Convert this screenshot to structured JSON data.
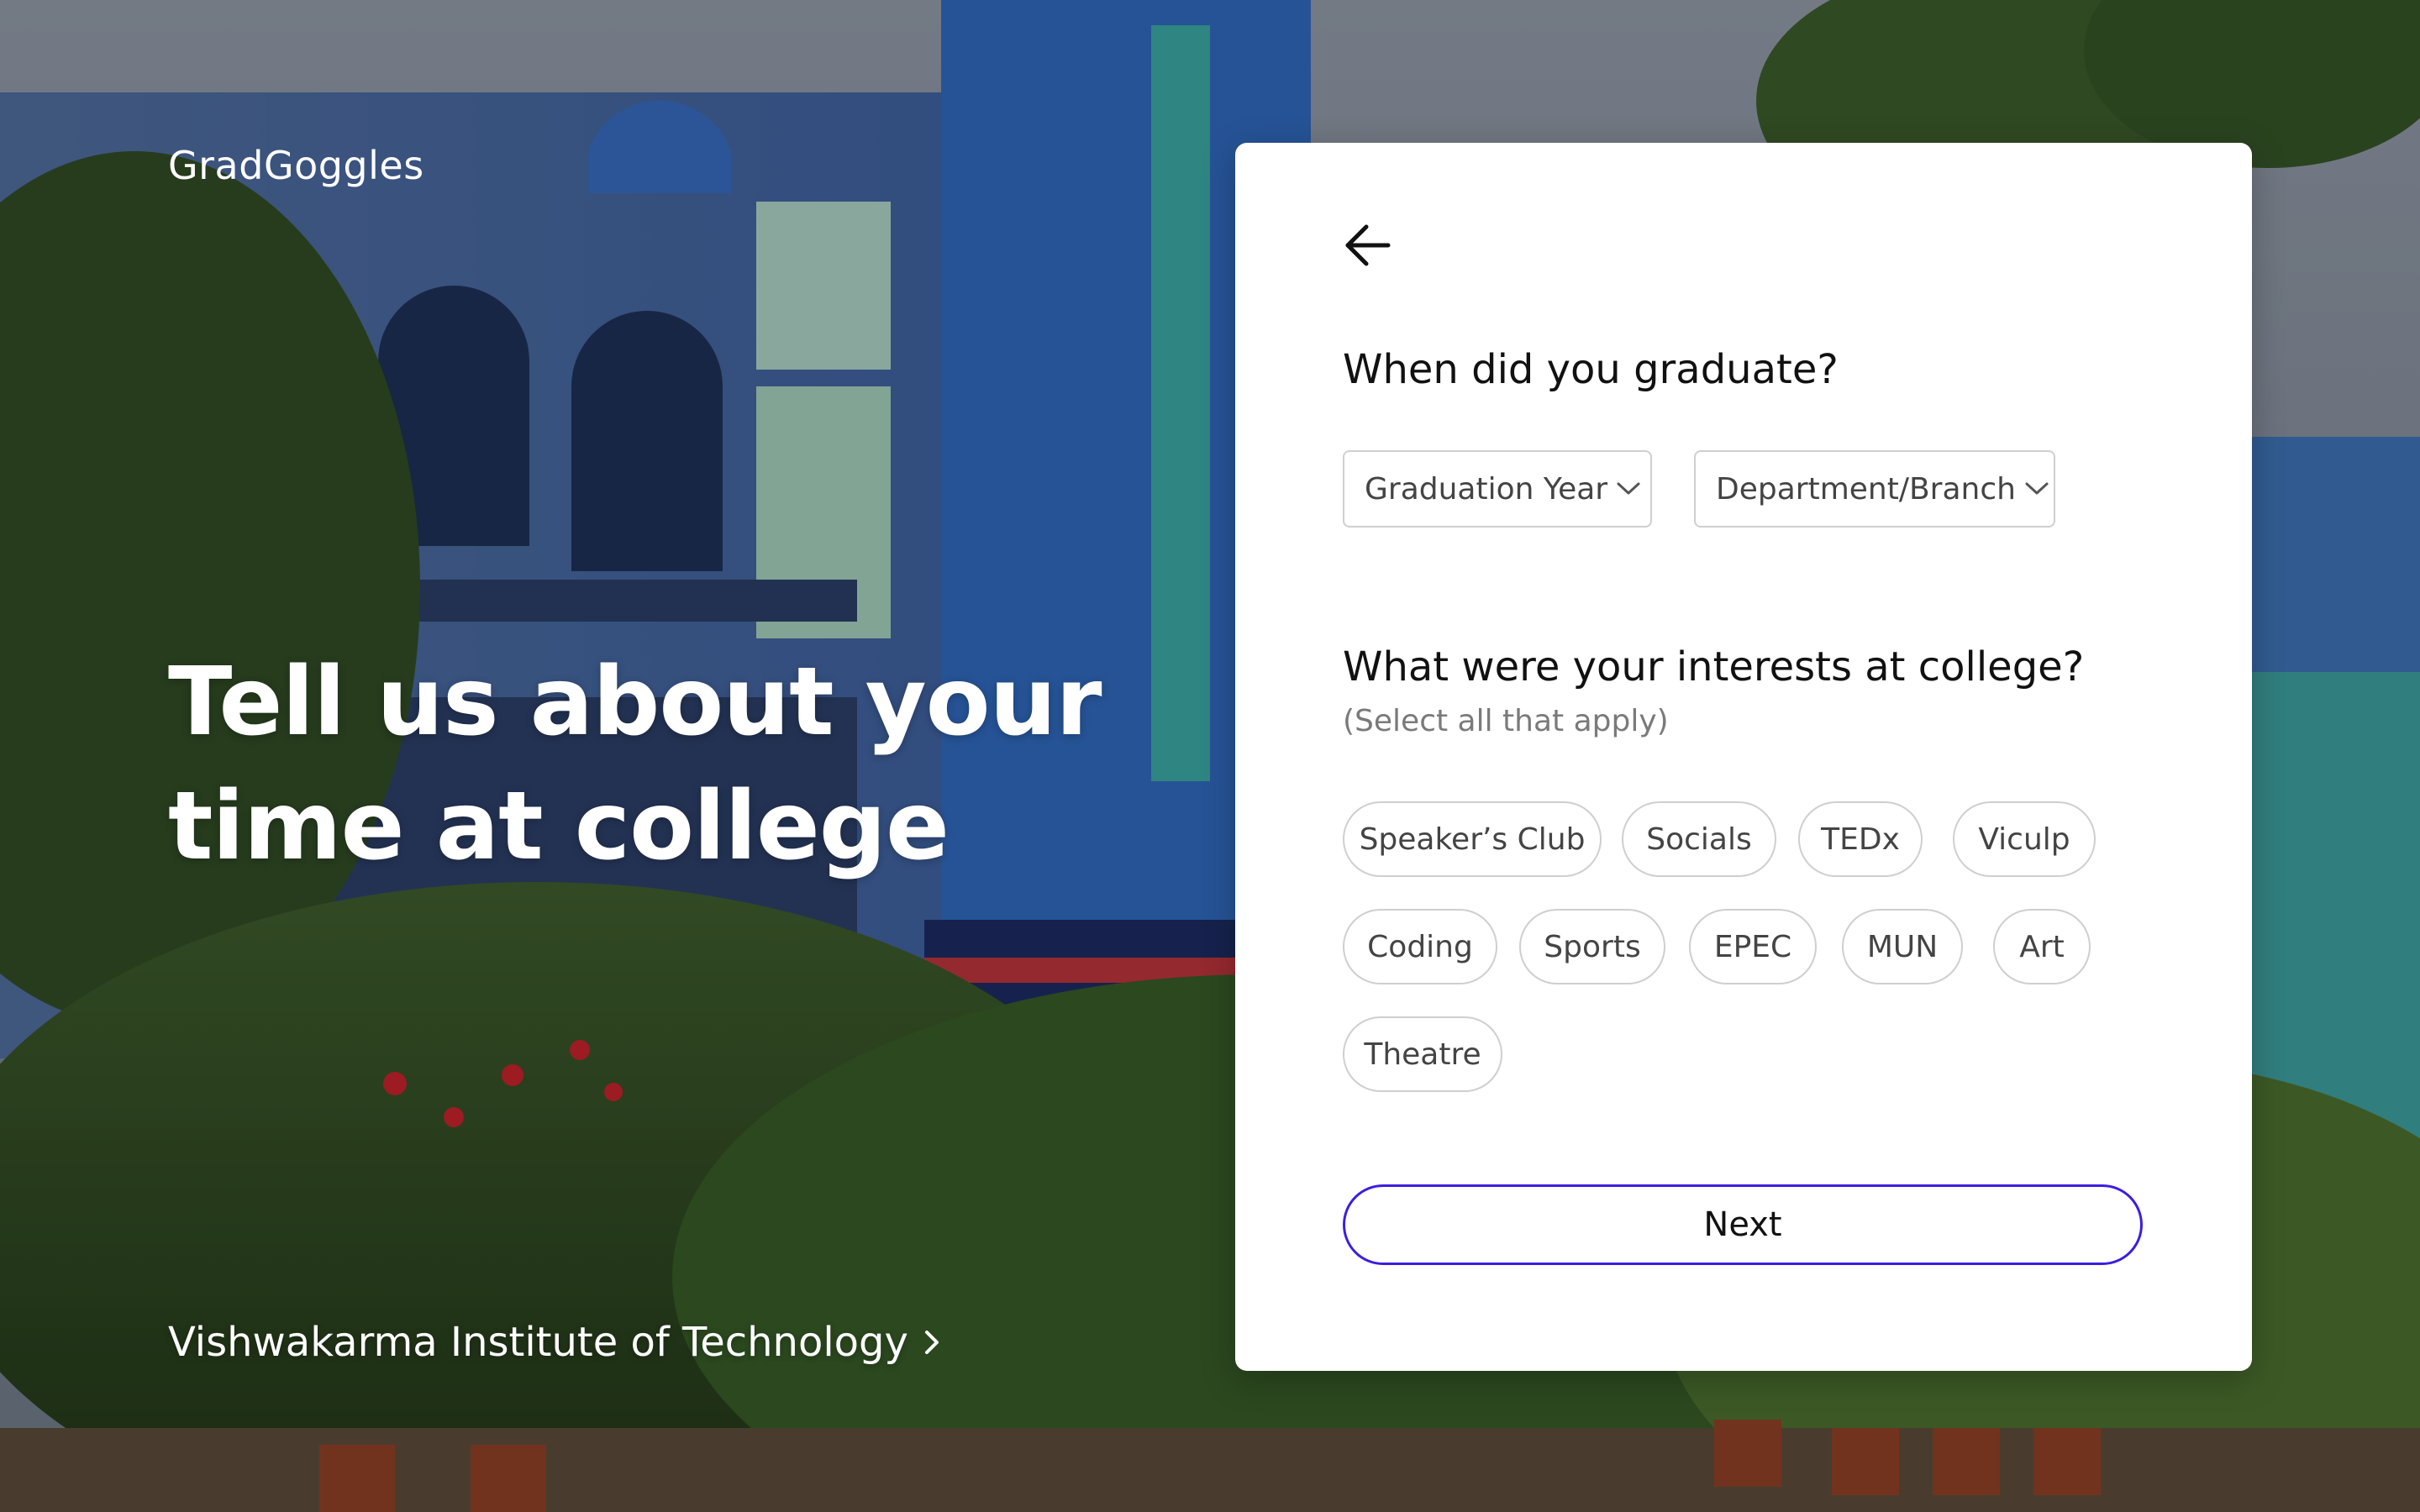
{
  "brand": {
    "name": "GradGoggles"
  },
  "hero": {
    "line1": "Tell us about your",
    "line2": "time at college"
  },
  "college": {
    "name": "Vishwakarma Institute of Technology",
    "icon": "chevron-right-icon"
  },
  "card": {
    "back_icon": "arrow-left-icon",
    "graduation": {
      "question": "When did you graduate?",
      "year_dropdown": {
        "label": "Graduation Year",
        "icon": "chevron-down-icon"
      },
      "dept_dropdown": {
        "label": "Department/Branch",
        "icon": "chevron-down-icon"
      }
    },
    "interests": {
      "question": "What were your interests at college?",
      "hint": "(Select all that apply)",
      "options": [
        "Speaker’s Club",
        "Socials",
        "TEDx",
        "Viculp",
        "Coding",
        "Sports",
        "EPEC",
        "MUN",
        "Art",
        "Theatre"
      ]
    },
    "next_label": "Next"
  },
  "colors": {
    "accent": "#3a1fe0",
    "card_bg": "#ffffff",
    "chip_border": "#cfcfcf",
    "hint_text": "#7a7a7a"
  }
}
